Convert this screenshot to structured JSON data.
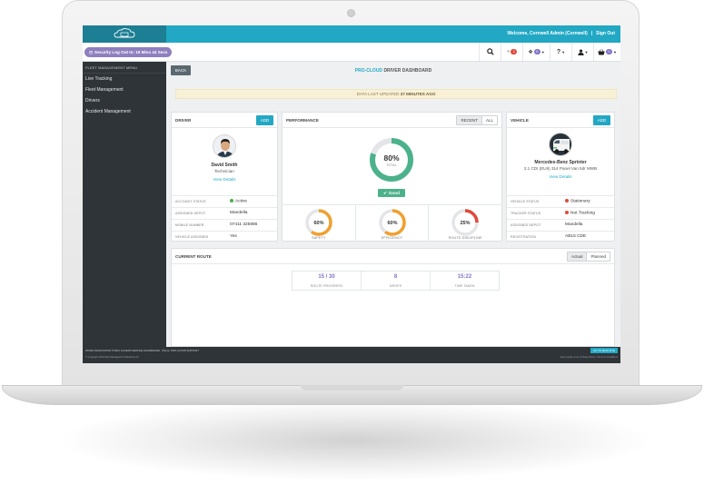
{
  "header": {
    "welcome_text": "Welcome, Cornwell Admin (Cornwell)",
    "separator": "|",
    "sign_out": "Sign Out"
  },
  "toolbar": {
    "security_pill": "Security Log Out In: 19 Mins 44 Secs",
    "alerts_badge": "1",
    "dropbox_badge": "0",
    "cart_badge": "0"
  },
  "sidebar": {
    "heading": "FLEET MANAGEMENT MENU",
    "items": [
      {
        "label": "Live Tracking"
      },
      {
        "label": "Fleet Management"
      },
      {
        "label": "Drivers"
      },
      {
        "label": "Accident Management"
      }
    ]
  },
  "page": {
    "back_label": "BACK",
    "title_brand": "PRO-CLOUD",
    "title_rest": "DRIVER DASHBOARD",
    "alert_prefix": "DATA LAST UPDATED",
    "alert_value": "37 MINUTES AGO"
  },
  "driver": {
    "panel_title": "DRIVER",
    "add_label": "ADD",
    "name": "David Smith",
    "role": "Technician",
    "view_details": "View Details",
    "fields": [
      {
        "key": "ACCOUNT STATUS",
        "value": "Active",
        "dot": "#4cae4c"
      },
      {
        "key": "ASSIGNED DEPOT",
        "value": "Mandella"
      },
      {
        "key": "MOBILE NUMBER",
        "value": "07411 325886"
      },
      {
        "key": "VEHICLE ASSIGNED",
        "value": "Yes"
      }
    ]
  },
  "performance": {
    "panel_title": "PERFORMANCE",
    "tab_recent": "RECENT",
    "tab_all": "ALL",
    "total": {
      "value": 80,
      "display": "80%",
      "label": "TOTAL",
      "color": "#4cb28b"
    },
    "rating": "Good",
    "metrics": [
      {
        "label": "SAFETY",
        "value": 60,
        "display": "60%",
        "color": "#f0a030"
      },
      {
        "label": "EFFICIENCY",
        "value": 60,
        "display": "60%",
        "color": "#f0a030"
      },
      {
        "label": "ROUTE DISCIPLINE",
        "value": 25,
        "display": "25%",
        "color": "#e0493b"
      }
    ]
  },
  "vehicle": {
    "panel_title": "VEHICLE",
    "add_label": "ADD",
    "name": "Mercedes-Benz Sprinter",
    "description": "2.1 CDI (EU6) 314 Panel Van 5dr MWB",
    "view_details": "View Details",
    "fields": [
      {
        "key": "VEHICLE STATUS",
        "value": "Stationary",
        "dot": "#e0493b"
      },
      {
        "key": "TRACKER STATUS",
        "value": "Not Tracking",
        "dot": "#e0493b"
      },
      {
        "key": "ASSIGNED DEPOT",
        "value": "Mandella"
      },
      {
        "key": "REGISTRATION",
        "value": "AB15 CDE"
      }
    ]
  },
  "route": {
    "panel_title": "CURRENT ROUTE",
    "tab_actual": "Actual",
    "tab_planned": "Planned",
    "stats": [
      {
        "value": "15 / 30",
        "label": "ROUTE PROGRESS"
      },
      {
        "value": "8",
        "label": "DROPS"
      },
      {
        "value": "15:22",
        "label": "TIME TAKEN"
      }
    ]
  },
  "footer": {
    "line1": "WORK ASSOCIATION TODAY ACCESS SERVICE DASHBOARD",
    "line2": "Phone: PRO-CLOUD SUPPORT",
    "line3": "© Copyright 2016 Fleet Management Solutions Ltd",
    "right_text": "www.mysite.co.uk | Privacy Policy | Terms & Conditions",
    "button": "GO TO MAIN SITE"
  }
}
